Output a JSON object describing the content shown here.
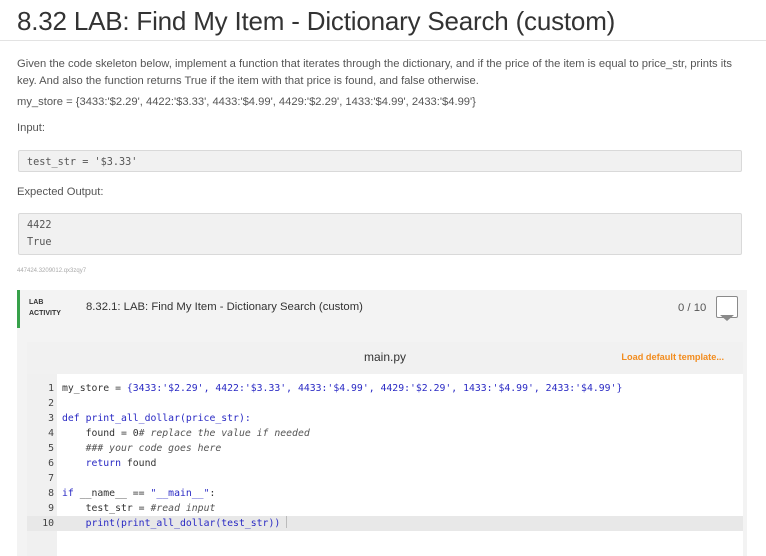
{
  "header": {
    "title": "8.32 LAB: Find My Item - Dictionary Search (custom)"
  },
  "description": {
    "text": "Given the code skeleton below, implement a function that iterates through the dictionary, and if the price of the item is equal to price_str, prints its key. And also the function returns True if the item with that price is found, and false otherwise.",
    "store": "my_store = {3433:'$2.29', 4422:'$3.33', 4433:'$4.99', 4429:'$2.29', 1433:'$4.99', 2433:'$4.99'}"
  },
  "input": {
    "label": "Input:",
    "lines": [
      "test_str = '$3.33'"
    ]
  },
  "expected_output": {
    "label": "Expected Output:",
    "lines": [
      "4422",
      "True"
    ]
  },
  "meta_id": "447424.3209012.qx3zqy7",
  "activity": {
    "tag_line1": "LAB",
    "tag_line2": "ACTIVITY",
    "name": "8.32.1: LAB: Find My Item - Dictionary Search (custom)",
    "score": "0 / 10"
  },
  "editor": {
    "file_name": "main.py",
    "load_template_label": "Load default template...",
    "lines": [
      {
        "num": "1",
        "segments": [
          {
            "t": "my_store = "
          },
          {
            "t": "{3433:'$2.29', 4422:'$3.33', 4433:'$4.99', 4429:'$2.29', 1433:'$4.99', 2433:'$4.99'}",
            "c": "str"
          }
        ]
      },
      {
        "num": "2",
        "segments": []
      },
      {
        "num": "3",
        "segments": [
          {
            "t": "def ",
            "c": "kw"
          },
          {
            "t": "print_all_dollar(price_str):",
            "c": "kw"
          }
        ]
      },
      {
        "num": "4",
        "segments": [
          {
            "t": "    found = 0"
          },
          {
            "t": "# replace the value if needed",
            "c": "cm"
          }
        ]
      },
      {
        "num": "5",
        "segments": [
          {
            "t": "    "
          },
          {
            "t": "### your code goes here",
            "c": "cm"
          }
        ]
      },
      {
        "num": "6",
        "segments": [
          {
            "t": "    "
          },
          {
            "t": "return",
            "c": "kw"
          },
          {
            "t": " found"
          }
        ]
      },
      {
        "num": "7",
        "segments": []
      },
      {
        "num": "8",
        "segments": [
          {
            "t": "if",
            "c": "kw"
          },
          {
            "t": " __name__ == "
          },
          {
            "t": "\"__main__\"",
            "c": "str"
          },
          {
            "t": ":"
          }
        ]
      },
      {
        "num": "9",
        "segments": [
          {
            "t": "    test_str = "
          },
          {
            "t": "#read input",
            "c": "cm"
          }
        ]
      },
      {
        "num": "10",
        "segments": [
          {
            "t": "    "
          },
          {
            "t": "print",
            "c": "kw"
          },
          {
            "t": "(print_all_dollar(test_str))",
            "c": "kw"
          }
        ],
        "active": true
      }
    ]
  },
  "colors": {
    "accent_green": "#37a14a",
    "link_orange": "#f28c1e",
    "code_blue": "#2a2ac4"
  }
}
